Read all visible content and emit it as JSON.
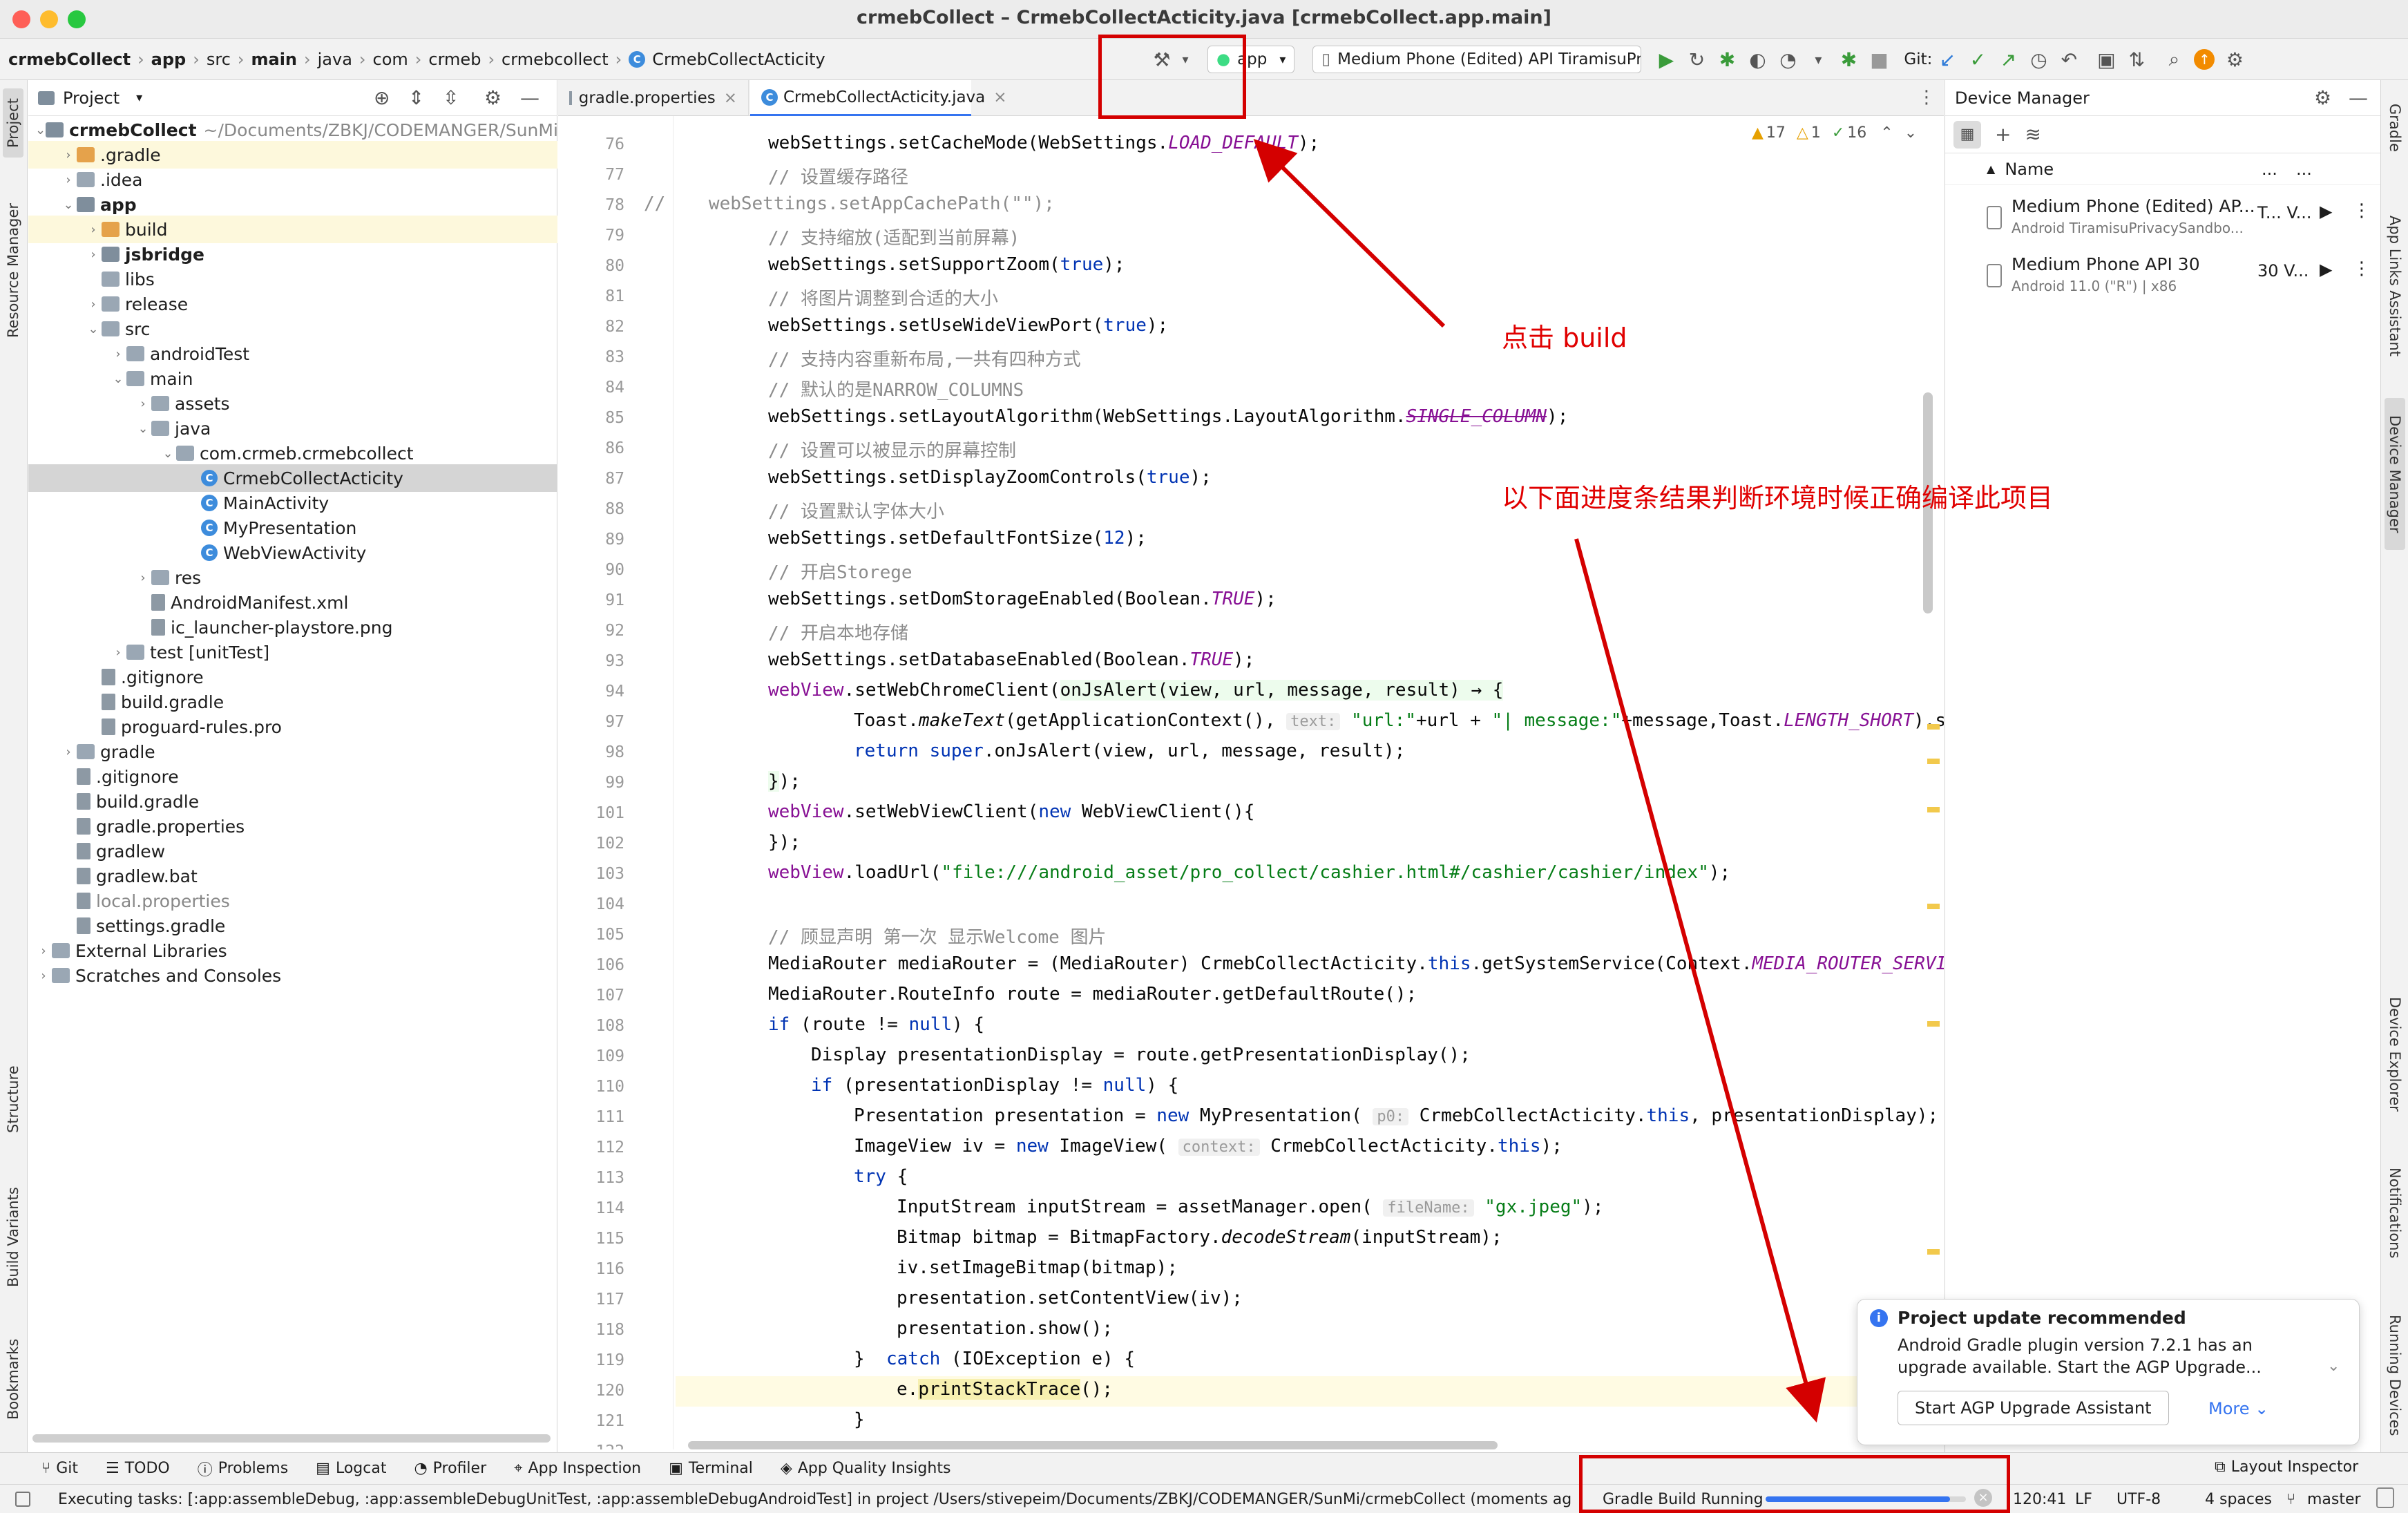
{
  "window": {
    "title": "crmebCollect – CrmebCollectActicity.java [crmebCollect.app.main]"
  },
  "breadcrumb": [
    "crmebCollect",
    "app",
    "src",
    "main",
    "java",
    "com",
    "crmeb",
    "crmebcollect",
    "CrmebCollectActicity"
  ],
  "toolbar": {
    "run_config": "app",
    "device": "Medium Phone (Edited) API TiramisuPr...",
    "git_label": "Git:"
  },
  "project_panel": {
    "title": "Project",
    "tree": [
      {
        "label": "crmebCollect",
        "path": "~/Documents/ZBKJ/CODEMANGER/SunMi",
        "level": 0,
        "type": "module"
      },
      {
        "label": ".gradle",
        "level": 1,
        "type": "folder-orange"
      },
      {
        "label": ".idea",
        "level": 1,
        "type": "folder"
      },
      {
        "label": "app",
        "level": 1,
        "type": "module"
      },
      {
        "label": "build",
        "level": 2,
        "type": "folder-orange"
      },
      {
        "label": "jsbridge",
        "level": 2,
        "type": "module"
      },
      {
        "label": "libs",
        "level": 2,
        "type": "folder"
      },
      {
        "label": "release",
        "level": 2,
        "type": "folder"
      },
      {
        "label": "src",
        "level": 2,
        "type": "folder"
      },
      {
        "label": "androidTest",
        "level": 3,
        "type": "folder"
      },
      {
        "label": "main",
        "level": 3,
        "type": "folder"
      },
      {
        "label": "assets",
        "level": 4,
        "type": "folder"
      },
      {
        "label": "java",
        "level": 4,
        "type": "folder"
      },
      {
        "label": "com.crmeb.crmebcollect",
        "level": 5,
        "type": "folder"
      },
      {
        "label": "CrmebCollectActicity",
        "level": 6,
        "type": "class"
      },
      {
        "label": "MainActivity",
        "level": 6,
        "type": "class"
      },
      {
        "label": "MyPresentation",
        "level": 6,
        "type": "class"
      },
      {
        "label": "WebViewActivity",
        "level": 6,
        "type": "class"
      },
      {
        "label": "res",
        "level": 4,
        "type": "folder"
      },
      {
        "label": "AndroidManifest.xml",
        "level": 4,
        "type": "file"
      },
      {
        "label": "ic_launcher-playstore.png",
        "level": 4,
        "type": "file"
      },
      {
        "label": "test [unitTest]",
        "level": 3,
        "type": "folder"
      },
      {
        "label": ".gitignore",
        "level": 2,
        "type": "file"
      },
      {
        "label": "build.gradle",
        "level": 2,
        "type": "file"
      },
      {
        "label": "proguard-rules.pro",
        "level": 2,
        "type": "file"
      },
      {
        "label": "gradle",
        "level": 1,
        "type": "folder"
      },
      {
        "label": ".gitignore",
        "level": 1,
        "type": "file"
      },
      {
        "label": "build.gradle",
        "level": 1,
        "type": "file"
      },
      {
        "label": "gradle.properties",
        "level": 1,
        "type": "file"
      },
      {
        "label": "gradlew",
        "level": 1,
        "type": "file"
      },
      {
        "label": "gradlew.bat",
        "level": 1,
        "type": "file"
      },
      {
        "label": "local.properties",
        "level": 1,
        "type": "file"
      },
      {
        "label": "settings.gradle",
        "level": 1,
        "type": "file"
      },
      {
        "label": "External Libraries",
        "level": 0,
        "type": "lib"
      },
      {
        "label": "Scratches and Consoles",
        "level": 0,
        "type": "lib"
      }
    ]
  },
  "editor": {
    "tabs": [
      "gradle.properties",
      "CrmebCollectActicity.java"
    ],
    "inspections": {
      "warnings": "17",
      "weak": "1",
      "ok": "16"
    },
    "lines": [
      {
        "n": "76",
        "html": "webSettings.setCacheMode(WebSettings.<span class=fld>LOAD_DEFAULT</span>);"
      },
      {
        "n": "77",
        "html": "<span class=cm>// 设置缓存路径</span>"
      },
      {
        "n": "78",
        "html": "<span class=cm>//    webSettings.setAppCachePath(\"\");</span>",
        "offset": -180
      },
      {
        "n": "79",
        "html": "<span class=cm>// 支持缩放(适配到当前屏幕)</span>"
      },
      {
        "n": "80",
        "html": "webSettings.setSupportZoom(<span class=kw>true</span>);"
      },
      {
        "n": "81",
        "html": "<span class=cm>// 将图片调整到合适的大小</span>"
      },
      {
        "n": "82",
        "html": "webSettings.setUseWideViewPort(<span class=kw>true</span>);"
      },
      {
        "n": "83",
        "html": "<span class=cm>// 支持内容重新布局,一共有四种方式</span>"
      },
      {
        "n": "84",
        "html": "<span class=cm>// 默认的是NARROW_COLUMNS</span>"
      },
      {
        "n": "85",
        "html": "webSettings.setLayoutAlgorithm(WebSettings.LayoutAlgorithm.<span class=fld style='text-decoration:line-through'>SINGLE_COLUMN</span>);"
      },
      {
        "n": "86",
        "html": "<span class=cm>// 设置可以被显示的屏幕控制</span>"
      },
      {
        "n": "87",
        "html": "webSettings.setDisplayZoomControls(<span class=kw>true</span>);"
      },
      {
        "n": "88",
        "html": "<span class=cm>// 设置默认字体大小</span>"
      },
      {
        "n": "89",
        "html": "webSettings.setDefaultFontSize(<span class=kw>12</span>);"
      },
      {
        "n": "90",
        "html": "<span class=cm>// 开启Storege</span>"
      },
      {
        "n": "91",
        "html": "webSettings.setDomStorageEnabled(Boolean.<span class=fld>TRUE</span>);"
      },
      {
        "n": "92",
        "html": "<span class=cm>// 开启本地存储</span>"
      },
      {
        "n": "93",
        "html": "webSettings.setDatabaseEnabled(Boolean.<span class=fld>TRUE</span>);"
      },
      {
        "n": "94",
        "html": "<span style='color:#871094'>webView</span>.setWebChromeClient(<span style='background:#edfced'>onJsAlert(view, url, message, result) → {</span>"
      },
      {
        "n": "97",
        "html": "    Toast.<i>makeText</i>(getApplicationContext(), <span class=hint>text:</span> <span class=st>\"url:\"</span>+url + <span class=st>\"| message:\"</span>+message,Toast.<span class=fld>LENGTH_SHORT</span>).show();"
      },
      {
        "n": "98",
        "html": "    <span class=kw>return super</span>.onJsAlert(view, url, message, result);"
      },
      {
        "n": "99",
        "html": "<span style='background:#edfced'>}</span>);"
      },
      {
        "n": "101",
        "html": "<span style='color:#871094'>webView</span>.setWebViewClient(<span class=kw>new</span> WebViewClient(){"
      },
      {
        "n": "102",
        "html": "});"
      },
      {
        "n": "103",
        "html": "<span style='color:#871094'>webView</span>.loadUrl(<span class=st>\"file:///android_asset/pro_collect/cashier.html#/cashier/cashier/index\"</span>);"
      },
      {
        "n": "104",
        "html": ""
      },
      {
        "n": "105",
        "html": "<span class=cm>// 顾显声明 第一次 显示Welcome 图片</span>"
      },
      {
        "n": "106",
        "html": "MediaRouter mediaRouter = (MediaRouter) CrmebCollectActicity.<span class=kw>this</span>.getSystemService(Context.<span class=fld>MEDIA_ROUTER_SERVICE</span>);"
      },
      {
        "n": "107",
        "html": "MediaRouter.RouteInfo route = mediaRouter.getDefaultRoute();"
      },
      {
        "n": "108",
        "html": "<span class=kw>if</span> (route != <span class=kw>null</span>) {"
      },
      {
        "n": "109",
        "html": "  Display presentationDisplay = route.getPresentationDisplay();"
      },
      {
        "n": "110",
        "html": "  <span class=kw>if</span> (presentationDisplay != <span class=kw>null</span>) {"
      },
      {
        "n": "111",
        "html": "    Presentation presentation = <span class=kw>new</span> MyPresentation( <span class=hint>p0:</span> CrmebCollectActicity.<span class=kw>this</span>, presentationDisplay);"
      },
      {
        "n": "112",
        "html": "    ImageView iv = <span class=kw>new</span> ImageView( <span class=hint>context:</span> CrmebCollectActicity.<span class=kw>this</span>);"
      },
      {
        "n": "113",
        "html": "    <span class=kw>try</span> {"
      },
      {
        "n": "114",
        "html": "      InputStream inputStream = assetManager.open( <span class=hint>fileName:</span> <span class=st>\"gx.jpeg\"</span>);"
      },
      {
        "n": "115",
        "html": "      Bitmap bitmap = BitmapFactory.<i>decodeStream</i>(inputStream);"
      },
      {
        "n": "116",
        "html": "      iv.setImageBitmap(bitmap);"
      },
      {
        "n": "117",
        "html": "      presentation.setContentView(iv);"
      },
      {
        "n": "118",
        "html": "      presentation.show();"
      },
      {
        "n": "119",
        "html": "    }  <span class=kw>catch</span> (IOException e) {"
      },
      {
        "n": "120",
        "html": "      e.<span style='background:#f7f0b0'>printStackTrace</span>();",
        "highlight": true
      },
      {
        "n": "121",
        "html": "    }"
      },
      {
        "n": "122",
        "html": ""
      }
    ]
  },
  "device_manager": {
    "title": "Device Manager",
    "column": "Name",
    "col2": "...",
    "col3": "...",
    "devices": [
      {
        "name": "Medium Phone (Edited) AP...",
        "sub": "Android TiramisuPrivacySandbo...",
        "col2": "T... V..."
      },
      {
        "name": "Medium Phone API 30",
        "sub": "Android 11.0 (\"R\") | x86",
        "col2": "30 V..."
      }
    ]
  },
  "notification": {
    "title": "Project update recommended",
    "body": "Android Gradle plugin version 7.2.1 has an upgrade available. Start the AGP Upgrade...",
    "button": "Start AGP Upgrade Assistant",
    "more": "More"
  },
  "bottom_tools": [
    "Git",
    "TODO",
    "Problems",
    "Logcat",
    "Profiler",
    "App Inspection",
    "Terminal",
    "App Quality Insights"
  ],
  "layout_inspector": "Layout Inspector",
  "status": {
    "message": "Executing tasks: [:app:assembleDebug, :app:assembleDebugUnitTest, :app:assembleDebugAndroidTest] in project /Users/stivepeim/Documents/ZBKJ/CODEMANGER/SunMi/crmebCollect (moments ago)",
    "build": "Gradle Build Running",
    "build_progress": 0.92,
    "position": "120:41",
    "line_sep": "LF",
    "encoding": "UTF-8",
    "indent": "4 spaces",
    "branch": "master"
  },
  "left_stripe": [
    "Project",
    "Resource Manager",
    "Structure",
    "Build Variants",
    "Bookmarks"
  ],
  "right_stripe": [
    "Gradle",
    "App Links Assistant",
    "Device Manager",
    "Device Explorer",
    "Notifications",
    "Running Devices"
  ],
  "annotations": {
    "click_build": "点击 build",
    "progress_note": "以下面进度条结果判断环境时候正确编译此项目"
  },
  "colors": {
    "annotation": "#d40000",
    "keyword": "#0033b3",
    "string": "#067d17",
    "comment": "#8c8c8c",
    "selection": "#d5d5d5"
  }
}
